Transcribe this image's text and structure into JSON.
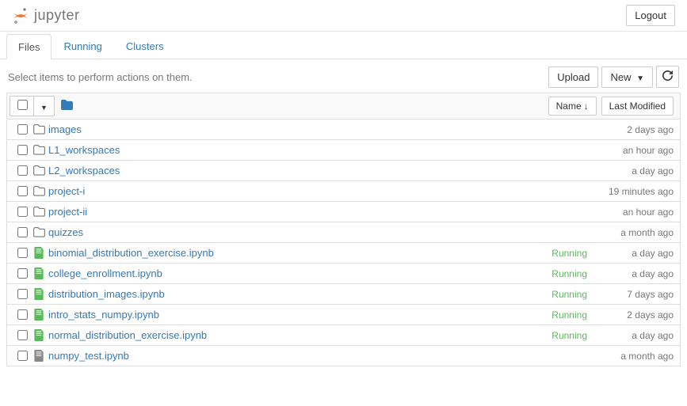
{
  "brand": "jupyter",
  "logout_label": "Logout",
  "tabs": {
    "files": "Files",
    "running": "Running",
    "clusters": "Clusters"
  },
  "instruction": "Select items to perform actions on them.",
  "upload_label": "Upload",
  "new_label": "New",
  "sort_name_label": "Name",
  "sort_modified_label": "Last Modified",
  "files": [
    {
      "name": "images",
      "type": "folder",
      "status": "",
      "modified": "2 days ago"
    },
    {
      "name": "L1_workspaces",
      "type": "folder",
      "status": "",
      "modified": "an hour ago"
    },
    {
      "name": "L2_workspaces",
      "type": "folder",
      "status": "",
      "modified": "a day ago"
    },
    {
      "name": "project-i",
      "type": "folder",
      "status": "",
      "modified": "19 minutes ago"
    },
    {
      "name": "project-ii",
      "type": "folder",
      "status": "",
      "modified": "an hour ago"
    },
    {
      "name": "quizzes",
      "type": "folder",
      "status": "",
      "modified": "a month ago"
    },
    {
      "name": "binomial_distribution_exercise.ipynb",
      "type": "notebook-running",
      "status": "Running",
      "modified": "a day ago"
    },
    {
      "name": "college_enrollment.ipynb",
      "type": "notebook-running",
      "status": "Running",
      "modified": "a day ago"
    },
    {
      "name": "distribution_images.ipynb",
      "type": "notebook-running",
      "status": "Running",
      "modified": "7 days ago"
    },
    {
      "name": "intro_stats_numpy.ipynb",
      "type": "notebook-running",
      "status": "Running",
      "modified": "2 days ago"
    },
    {
      "name": "normal_distribution_exercise.ipynb",
      "type": "notebook-running",
      "status": "Running",
      "modified": "a day ago"
    },
    {
      "name": "numpy_test.ipynb",
      "type": "notebook",
      "status": "",
      "modified": "a month ago"
    }
  ]
}
